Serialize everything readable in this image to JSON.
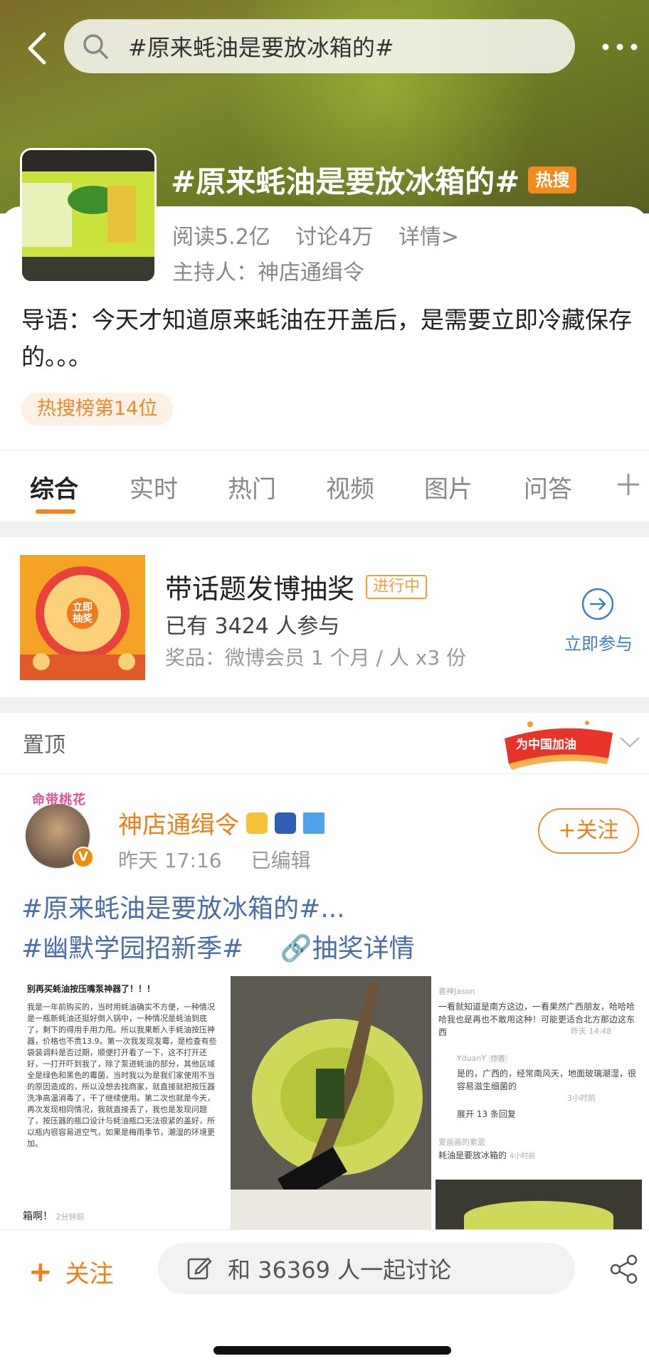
{
  "header": {
    "search_query": "#原来蚝油是要放冰箱的#",
    "icons": {
      "back": "chevron-left-icon",
      "search": "search-icon",
      "more": "more-dots-icon"
    }
  },
  "topic": {
    "title": "#原来蚝油是要放冰箱的#",
    "hot_badge": "热搜",
    "reads": "阅读5.2亿",
    "discussions": "讨论4万",
    "details": "详情>",
    "host": "主持人：神店通缉令",
    "intro": "导语：今天才知道原来蚝油在开盖后，是需要立即冷藏保存的。。。",
    "rank": "热搜榜第14位"
  },
  "tabs": [
    "综合",
    "实时",
    "热门",
    "视频",
    "图片",
    "问答"
  ],
  "lottery": {
    "title": "带话题发博抽奖",
    "status": "进行中",
    "participants": "已有 3424 人参与",
    "prize": "奖品：微博会员 1 个月 / 人 x3 份",
    "join_label": "立即参与",
    "image_text": "立即抽奖"
  },
  "pinned": {
    "label": "置顶",
    "badge_text": "为中国加油"
  },
  "post": {
    "username": "神店通缉令",
    "avatar_banner": "命带桃花",
    "time": "昨天 17:16",
    "edited": "已编辑",
    "follow_label": "+关注",
    "line1": "#原来蚝油是要放冰箱的#...",
    "tag2": "#幽默学园招新季#",
    "lottery_link": "抽奖详情",
    "image1": {
      "heading": "别再买蚝油按压嘴泵神器了！！！",
      "text": "我是一年前购买的，当时用蚝油确实不方便，一种情况是一瓶新蚝油还挺好倒入锅中，一种情况是蚝油到底了，剩下的得用手用力甩。所以我果断入手蚝油按压神器，价格也不贵13.9。第一次我发现发霉，是检查有些袋装调料是否过期，顺便打开看了一下，这不打开还好，一打开吓到我了，除了泵进蚝油的部分，其他区域全是绿色和黑色的霉菌，当时我以为是我们家使用不当的原因造成的，所以没想去找商家，就直接就把按压器洗净高温消毒了，干了继续使用。第二次也就是今天，再次发现相同情况，我就直接丢了，我也是发现问题了，按压器的瓶口设计与蚝油瓶口无法很紧的盖好，所以瓶内很容易进空气，如果是梅雨季节，潮湿的环境更加。",
      "footer": "箱啊！",
      "footer_time": "2分钟前"
    },
    "image3": {
      "c1_user": "善神Jason",
      "c1_text": "一看就知道是南方这边，一看果然广西朋友，哈哈哈哈我也是再也不敢用这种！可能更适合北方那边这东西",
      "c1_time": "昨天 14:48",
      "c2_user": "YduanY",
      "c2_tag": "作者",
      "c2_text": "是的，广西的，经常南风天，地面玻璃潮湿，很容易滋生细菌的",
      "c2_time": "3小时前",
      "expand": "展开 13 条回复",
      "c3_user": "爱画画的紫蓝",
      "c3_text": "耗油是要放冰箱的",
      "c3_time": "4小时前"
    }
  },
  "bottom_bar": {
    "follow": "关注",
    "discuss": "和 36369 人一起讨论",
    "icons": {
      "edit": "edit-icon",
      "share": "share-icon"
    }
  },
  "colors": {
    "accent": "#f07f17",
    "link": "#4a6ea8",
    "hot": "#f48a1b"
  }
}
